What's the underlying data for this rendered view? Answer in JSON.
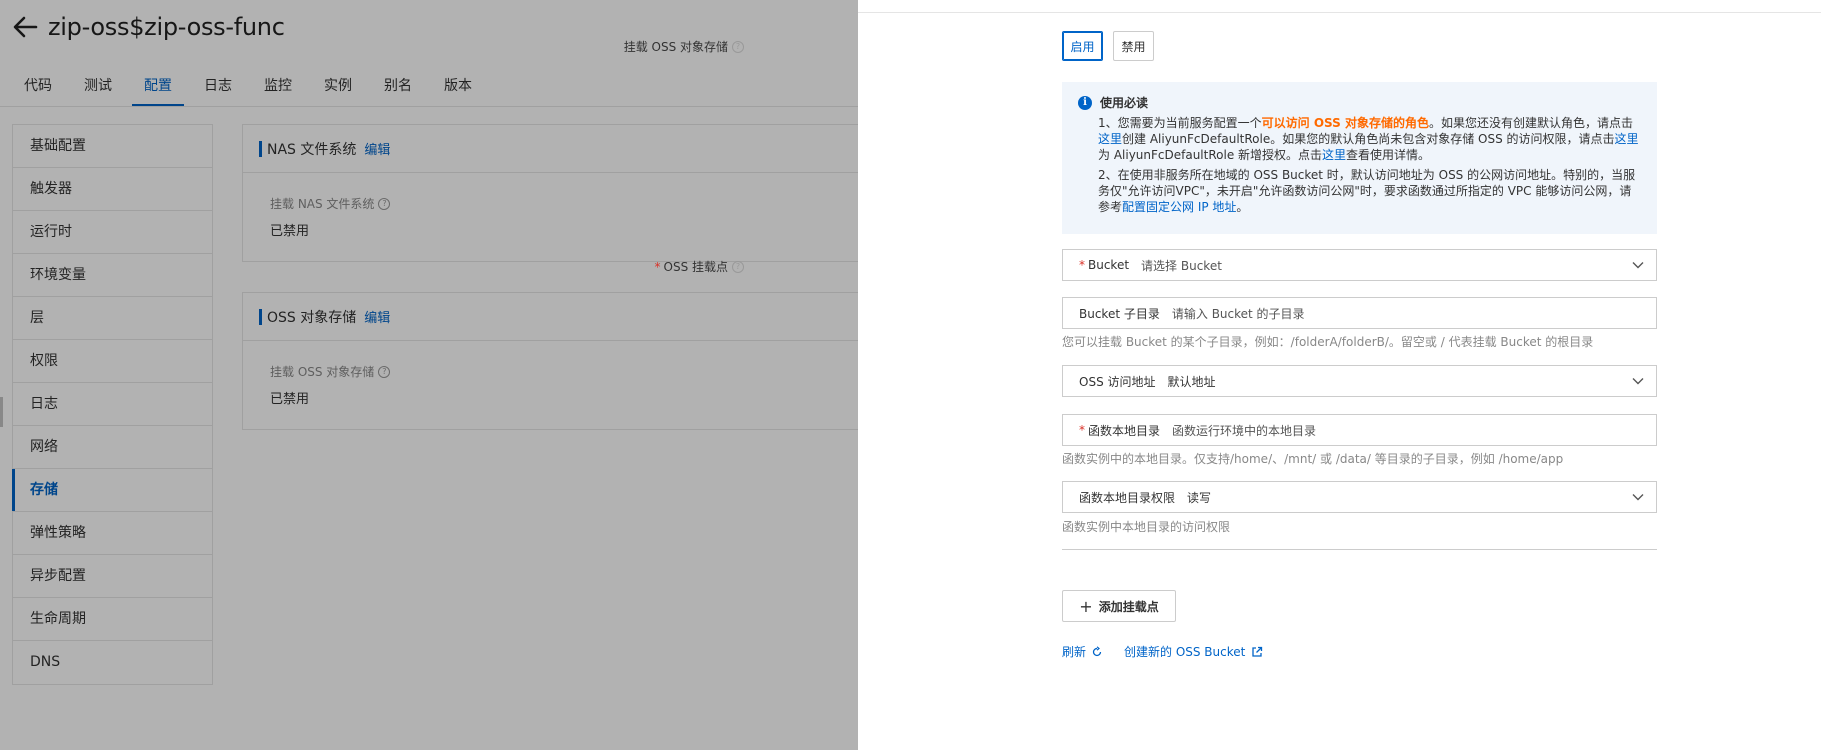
{
  "header": {
    "title": "zip-oss$zip-oss-func"
  },
  "tabs": [
    {
      "label": "代码"
    },
    {
      "label": "测试"
    },
    {
      "label": "配置"
    },
    {
      "label": "日志"
    },
    {
      "label": "监控"
    },
    {
      "label": "实例"
    },
    {
      "label": "别名"
    },
    {
      "label": "版本"
    }
  ],
  "active_tab": "配置",
  "sidebar": {
    "items": [
      {
        "label": "基础配置"
      },
      {
        "label": "触发器"
      },
      {
        "label": "运行时"
      },
      {
        "label": "环境变量"
      },
      {
        "label": "层"
      },
      {
        "label": "权限"
      },
      {
        "label": "日志"
      },
      {
        "label": "网络"
      },
      {
        "label": "存储"
      },
      {
        "label": "弹性策略"
      },
      {
        "label": "异步配置"
      },
      {
        "label": "生命周期"
      },
      {
        "label": "DNS"
      }
    ],
    "active": "存储"
  },
  "nas_card": {
    "title": "NAS 文件系统",
    "edit": "编辑",
    "field_label": "挂载 NAS 文件系统",
    "field_value": "已禁用"
  },
  "oss_card": {
    "title": "OSS 对象存储",
    "edit": "编辑",
    "field_label": "挂载 OSS 对象存储",
    "field_value": "已禁用"
  },
  "drawer": {
    "mount_label": "挂载 OSS 对象存储",
    "enable": "启用",
    "disable": "禁用",
    "notice": {
      "title": "使用必读",
      "p1_a": "1、您需要为当前服务配置一个",
      "p1_hl": "可以访问 OSS 对象存储的角色",
      "p1_b": "。如果您还没有创建默认角色，请点击",
      "p1_link1": "这里",
      "p1_c": "创建 AliyunFcDefaultRole。如果您的默认角色尚未包含对象存储 OSS 的访问权限，请点击",
      "p1_link2": "这里",
      "p1_d": "为 AliyunFcDefaultRole 新增授权。点击",
      "p1_link3": "这里",
      "p1_e": "查看使用详情。",
      "p2_a": "2、在使用非服务所在地域的 OSS Bucket 时，默认访问地址为 OSS 的公网访问地址。特别的，当服务仅\"允许访问VPC\"，未开启\"允许函数访问公网\"时，要求函数通过所指定的 VPC 能够访问公网，请参考",
      "p2_link": "配置固定公网 IP 地址",
      "p2_b": "。"
    },
    "mount_point_label": "OSS 挂载点",
    "bucket": {
      "label": "Bucket",
      "placeholder": "请选择 Bucket"
    },
    "subdir": {
      "label": "Bucket 子目录",
      "placeholder": "请输入 Bucket 的子目录",
      "hint": "您可以挂载 Bucket 的某个子目录，例如：/folderA/folderB/。留空或 / 代表挂载 Bucket 的根目录"
    },
    "endpoint": {
      "label": "OSS 访问地址",
      "value": "默认地址"
    },
    "local_dir": {
      "label": "函数本地目录",
      "placeholder": "函数运行环境中的本地目录",
      "hint": "函数实例中的本地目录。仅支持/home/、/mnt/ 或 /data/ 等目录的子目录，例如 /home/app"
    },
    "permission": {
      "label": "函数本地目录权限",
      "value": "读写",
      "hint": "函数实例中本地目录的访问权限"
    },
    "add_button": "添加挂载点",
    "refresh": "刷新",
    "create_bucket": "创建新的 OSS Bucket"
  }
}
